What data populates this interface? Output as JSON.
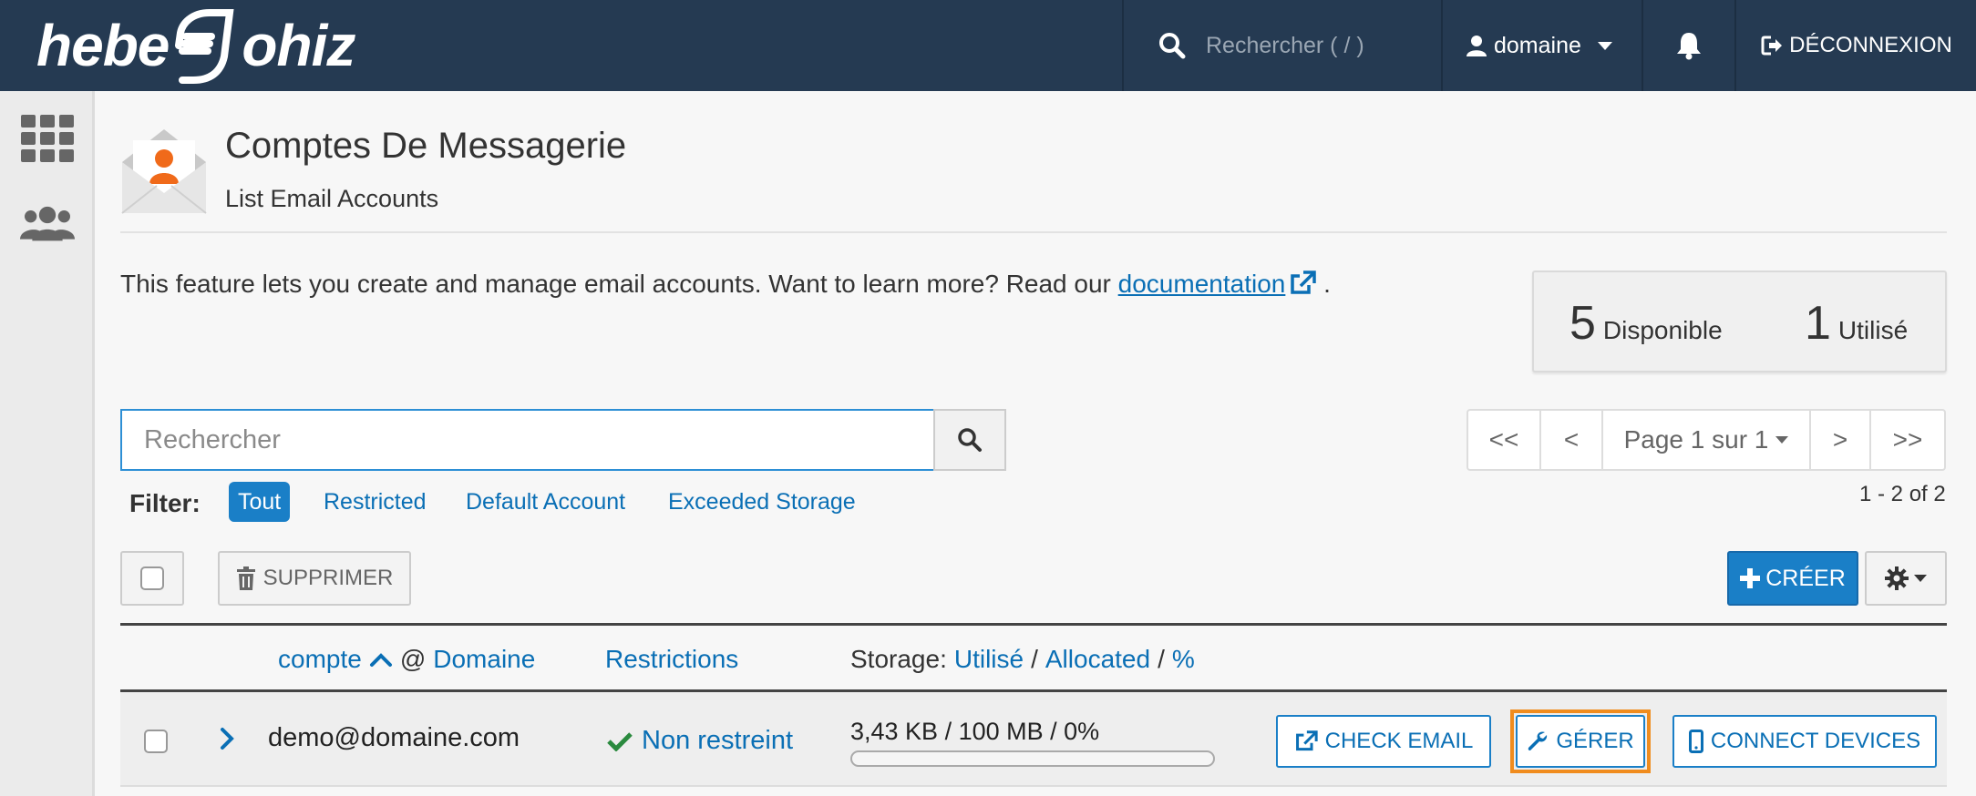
{
  "topbar": {
    "logo_left": "hebe",
    "logo_right": "ohiz",
    "search_placeholder": "Rechercher ( / )",
    "user": "domaine",
    "logout": "DÉCONNEXION"
  },
  "header": {
    "title": "Comptes De Messagerie",
    "subtitle": "List Email Accounts"
  },
  "intro": {
    "text": "This feature lets you create and manage email accounts. Want to learn more? Read our ",
    "link": "documentation",
    "suffix": "."
  },
  "stats": {
    "available_num": "5",
    "available_label": "Disponible",
    "used_num": "1",
    "used_label": "Utilisé"
  },
  "search": {
    "placeholder": "Rechercher"
  },
  "pager": {
    "first": "<<",
    "prev": "<",
    "page": "Page 1 sur 1",
    "next": ">",
    "last": ">>",
    "count": "1 - 2 of 2"
  },
  "filter": {
    "label": "Filter:",
    "options": [
      "Tout",
      "Restricted",
      "Default Account",
      "Exceeded Storage"
    ]
  },
  "actions": {
    "delete": "SUPPRIMER",
    "create": "CRÉER"
  },
  "table": {
    "headers": {
      "account": "compte",
      "at": "@",
      "domain": "Domaine",
      "restrictions": "Restrictions",
      "storage": "Storage:",
      "used": "Utilisé",
      "sep": "/",
      "allocated": "Allocated",
      "pct": "%"
    },
    "rows": [
      {
        "email": "demo@domaine.com",
        "restriction": "Non restreint",
        "storage": "3,43 KB / 100 MB / 0%",
        "storage_fraction": 0.0,
        "check_email": "CHECK EMAIL",
        "manage": "GÉRER",
        "connect": "CONNECT DEVICES"
      }
    ]
  },
  "colors": {
    "topbar": "#253a52",
    "accent": "#1a7fc7",
    "link": "#0a6fb5",
    "highlight": "#f08c1e",
    "success": "#2a8a3e"
  }
}
